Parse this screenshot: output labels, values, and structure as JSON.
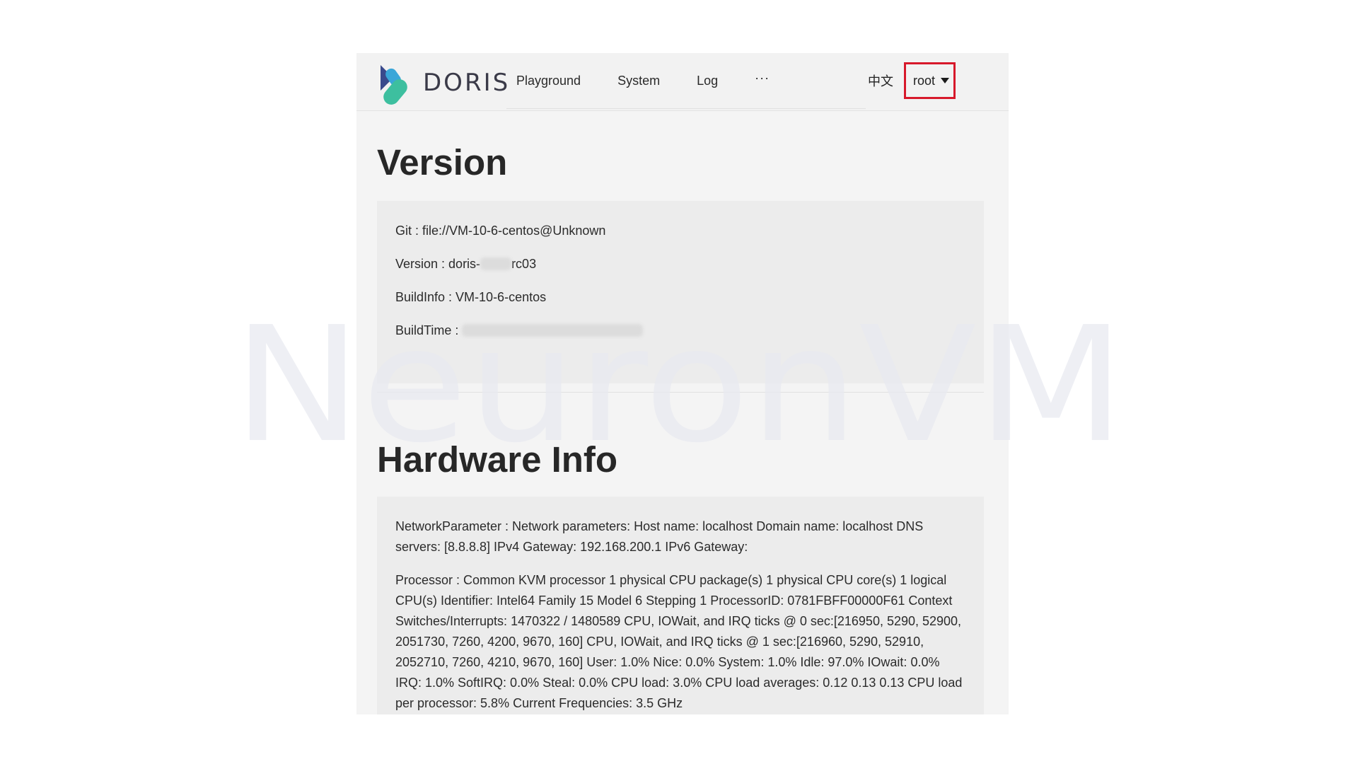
{
  "header": {
    "brand": "DORIS",
    "nav": [
      "Playground",
      "System",
      "Log"
    ],
    "more": "···",
    "language": "中文",
    "user": "root"
  },
  "version_section": {
    "title": "Version",
    "rows": {
      "git": "Git : file://VM-10-6-centos@Unknown",
      "version_prefix": "Version : doris-",
      "version_suffix": "rc03",
      "buildinfo": "BuildInfo : VM-10-6-centos",
      "buildtime": "BuildTime :"
    }
  },
  "hardware_section": {
    "title": "Hardware Info",
    "network": "NetworkParameter : Network parameters: Host name: localhost Domain name: localhost DNS servers: [8.8.8.8] IPv4 Gateway: 192.168.200.1 IPv6 Gateway:",
    "processor": "Processor : Common KVM processor 1 physical CPU package(s) 1 physical CPU core(s) 1 logical CPU(s) Identifier: Intel64 Family 15 Model 6 Stepping 1 ProcessorID: 0781FBFF00000F61 Context Switches/Interrupts: 1470322 / 1480589 CPU, IOWait, and IRQ ticks @ 0 sec:[216950, 5290, 52900, 2051730, 7260, 4200, 9670, 160] CPU, IOWait, and IRQ ticks @ 1 sec:[216960, 5290, 52910, 2052710, 7260, 4210, 9670, 160] User: 1.0% Nice: 0.0% System: 1.0% Idle: 97.0% IOwait: 0.0% IRQ: 1.0% SoftIRQ: 0.0% Steal: 0.0% CPU load: 3.0% CPU load averages: 0.12 0.13 0.13 CPU load per processor: 5.8% Current Frequencies: 3.5 GHz"
  },
  "watermark": "NeuronVM",
  "colors": {
    "highlight_border": "#d7192b",
    "logo_teal": "#3dbf9f",
    "logo_blue": "#3aa6d8",
    "logo_navy": "#3a4a8c",
    "watermark": "#e8e9f0"
  }
}
